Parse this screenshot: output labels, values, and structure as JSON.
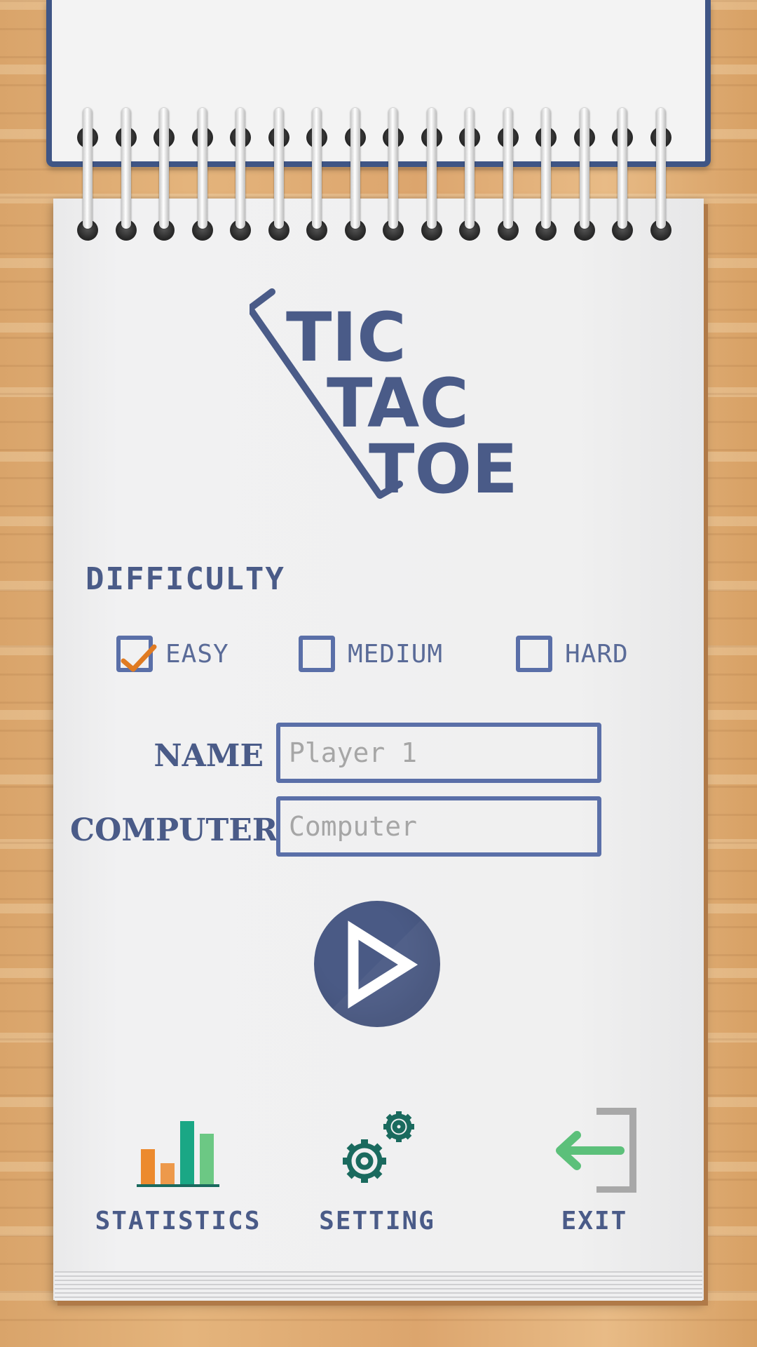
{
  "logo": {
    "line1": "TIC",
    "line2": "TAC",
    "line3": "TOE"
  },
  "difficulty": {
    "label": "DIFFICULTY",
    "options": [
      {
        "label": "EASY",
        "checked": true
      },
      {
        "label": "MEDIUM",
        "checked": false
      },
      {
        "label": "HARD",
        "checked": false
      }
    ]
  },
  "form": {
    "name_label": "NAME",
    "name_placeholder": "Player 1",
    "computer_label": "COMPUTER",
    "computer_placeholder": "Computer"
  },
  "play": {
    "icon": "play-icon"
  },
  "menu": {
    "statistics_label": "STATISTICS",
    "setting_label": "SETTING",
    "exit_label": "EXIT"
  },
  "colors": {
    "primary": "#4a5b88",
    "checkbox_border": "#5a6fa8",
    "check_mark": "#e07b22",
    "play_bg": "#4a5a85",
    "stats_orange": "#ec8a2e",
    "stats_teal": "#1aa785",
    "stats_green": "#6cc884",
    "gear": "#1a6a5e",
    "exit_arrow": "#5cc07a",
    "exit_door": "#a8a8a8"
  }
}
